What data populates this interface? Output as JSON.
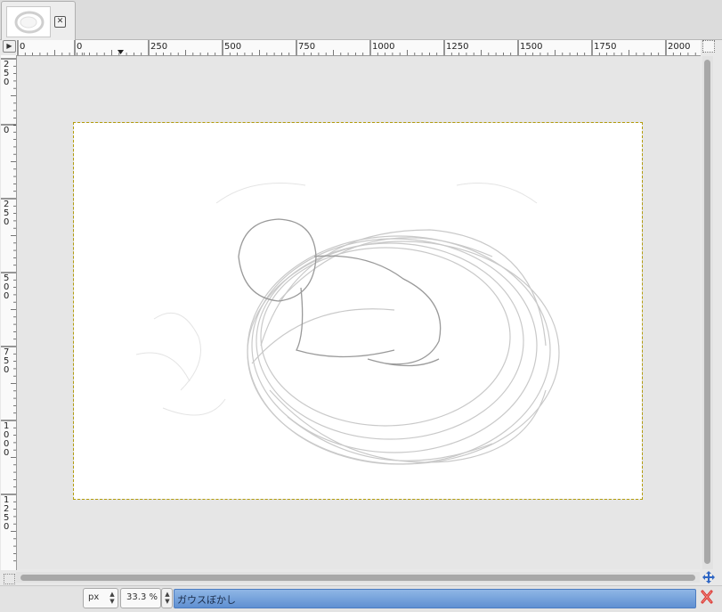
{
  "tab": {
    "close_icon": "close-icon"
  },
  "rulers": {
    "horizontal_labels": [
      "0",
      "0",
      "250",
      "500",
      "750",
      "1000",
      "1250",
      "1500",
      "1750",
      "2000"
    ],
    "vertical_labels": [
      "250",
      "0",
      "250",
      "500",
      "750",
      "1000",
      "1250"
    ]
  },
  "statusbar": {
    "unit": "px",
    "zoom": "33.3 %",
    "message": "ガウスぼかし"
  },
  "colors": {
    "selection_marching_ants": "#f2d200",
    "status_highlight": "#6f9fdb",
    "cancel": "#d9312b"
  }
}
